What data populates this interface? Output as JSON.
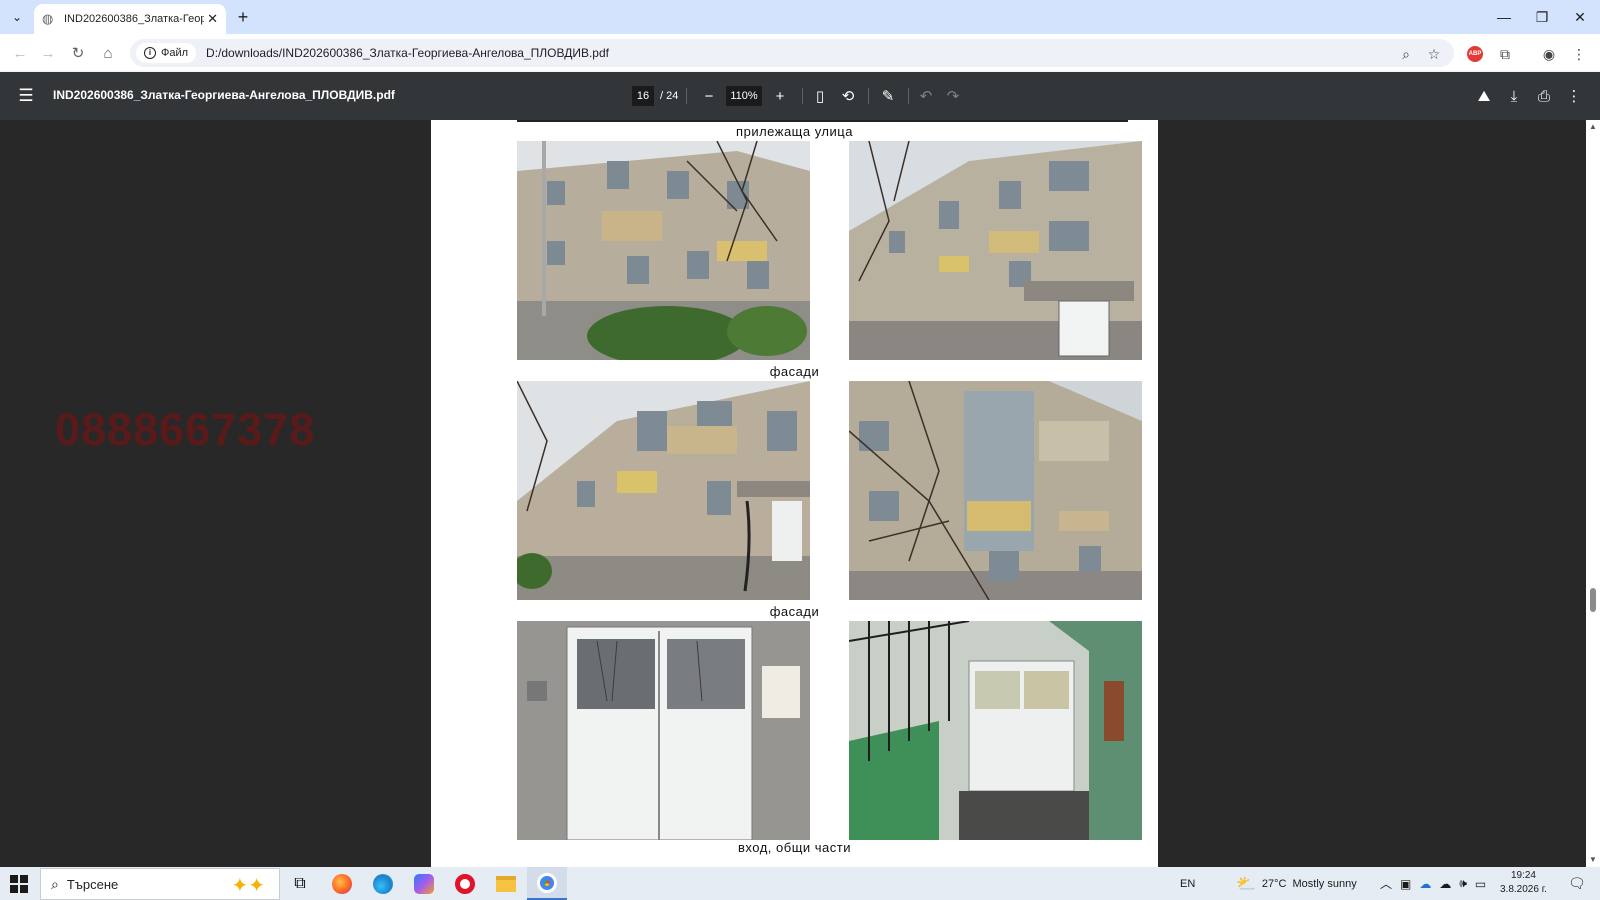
{
  "browser": {
    "tab_title": "IND202600386_Златка-Георгиева",
    "site_chip": "Файл",
    "url": "D:/downloads/IND202600386_Златка-Георгиева-Ангелова_ПЛОВДИВ.pdf"
  },
  "pdf_toolbar": {
    "file_name": "IND202600386_Златка-Георгиева-Ангелова_ПЛОВДИВ.pdf",
    "current_page": "16",
    "total_pages": "/ 24",
    "zoom": "110%"
  },
  "watermark": "0888667378",
  "document": {
    "captions": [
      "прилежаща улица",
      "фасади",
      "фасади",
      "вход, общи части"
    ]
  },
  "taskbar": {
    "search_placeholder": "Търсене",
    "language": "EN",
    "weather_temp": "27°C",
    "weather_text": "Mostly sunny",
    "time": "19:24",
    "date": "3.8.2026 г."
  },
  "icons": {
    "back": "arrow-left-icon",
    "forward": "arrow-right-icon",
    "reload": "reload-icon",
    "home": "home-icon",
    "zoom": "magnifier-icon",
    "bookmark": "star-icon",
    "extensions": "puzzle-icon",
    "profile": "account-icon",
    "more": "kebab-icon"
  },
  "colors": {
    "tabstrip": "#d3e3fd",
    "pdf_toolbar": "#323639",
    "viewer_bg": "#282828",
    "watermark": "#5a1a1a"
  }
}
